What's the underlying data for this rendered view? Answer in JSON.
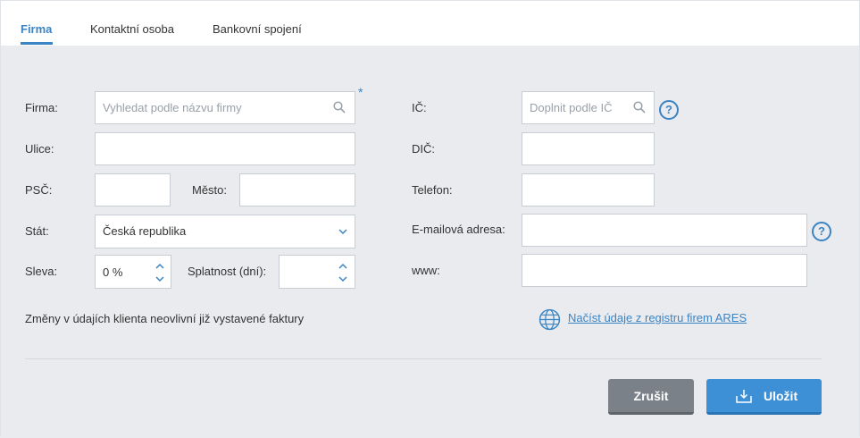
{
  "tabs": [
    {
      "label": "Firma",
      "active": true
    },
    {
      "label": "Kontaktní osoba",
      "active": false
    },
    {
      "label": "Bankovní spojení",
      "active": false
    }
  ],
  "required_marker": "*",
  "form": {
    "firma_label": "Firma:",
    "firma_placeholder": "Vyhledat podle názvu firmy",
    "ulice_label": "Ulice:",
    "psc_label": "PSČ:",
    "mesto_label": "Město:",
    "stat_label": "Stát:",
    "stat_value": "Česká republika",
    "sleva_label": "Sleva:",
    "sleva_value": "0 %",
    "splatnost_label": "Splatnost (dní):",
    "ic_label": "IČ:",
    "ic_placeholder": "Doplnit podle IČ",
    "dic_label": "DIČ:",
    "telefon_label": "Telefon:",
    "email_label": "E-mailová adresa:",
    "www_label": "www:",
    "help_glyph": "?"
  },
  "note": "Změny v údajích klienta neovlivní již vystavené faktury",
  "ares_link": "Načíst údaje z registru firem ARES",
  "buttons": {
    "cancel": "Zrušit",
    "save": "Uložit"
  },
  "colors": {
    "accent": "#3b84c4",
    "cancel_bg": "#7b8189",
    "save_bg": "#3d8fd6",
    "panel_bg": "#e9ebef"
  },
  "icons": [
    "search-icon",
    "help-icon",
    "chevron-down-icon",
    "chevron-up-icon",
    "globe-icon",
    "download-icon"
  ]
}
